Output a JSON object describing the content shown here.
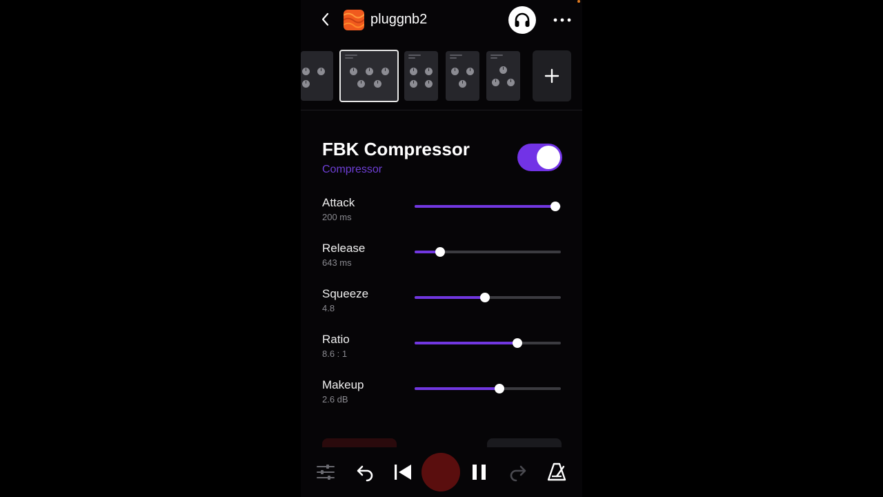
{
  "header": {
    "project_name": "pluggnb2",
    "icons": {
      "back": "chevron-left-icon",
      "project": "project-artwork-icon",
      "monitor": "headphones-icon",
      "menu": "more-icon"
    }
  },
  "pedals": [
    {
      "index": 0,
      "selected": false
    },
    {
      "index": 1,
      "selected": true
    },
    {
      "index": 2,
      "selected": false
    },
    {
      "index": 3,
      "selected": false
    },
    {
      "index": 4,
      "selected": false
    }
  ],
  "effect": {
    "name": "FBK Compressor",
    "type": "Compressor",
    "enabled": true
  },
  "params": [
    {
      "name": "Attack",
      "value": "200 ms",
      "level": 0.96
    },
    {
      "name": "Release",
      "value": "643 ms",
      "level": 0.175
    },
    {
      "name": "Squeeze",
      "value": "4.8",
      "level": 0.48
    },
    {
      "name": "Ratio",
      "value": "8.6 : 1",
      "level": 0.705
    },
    {
      "name": "Makeup",
      "value": "2.6 dB",
      "level": 0.58
    }
  ],
  "transport": {
    "icons": [
      "mixer-sliders-icon",
      "undo-icon",
      "skip-back-icon",
      "record-button",
      "pause-icon",
      "redo-icon",
      "metronome-icon"
    ]
  },
  "colors": {
    "accent": "#7233e6",
    "accent_text": "#6e3fd6",
    "record": "#5a0e0e",
    "background": "#060507"
  }
}
